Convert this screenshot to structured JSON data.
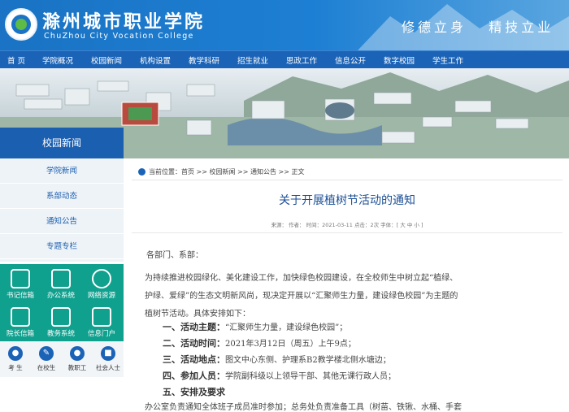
{
  "header": {
    "cn_name": "滁州城市职业学院",
    "en_name": "ChuZhou City Vocation College",
    "motto": "修德立身   精技立业"
  },
  "nav": [
    {
      "label": "首 页"
    },
    {
      "label": "学院概况"
    },
    {
      "label": "校园新闻"
    },
    {
      "label": "机构设置"
    },
    {
      "label": "教学科研"
    },
    {
      "label": "招生就业"
    },
    {
      "label": "思政工作"
    },
    {
      "label": "信息公开"
    },
    {
      "label": "数字校园"
    },
    {
      "label": "学生工作"
    }
  ],
  "sidebar": {
    "title": "校园新闻",
    "items": [
      {
        "label": "学院新闻"
      },
      {
        "label": "系部动态"
      },
      {
        "label": "通知公告"
      },
      {
        "label": "专题专栏"
      }
    ],
    "tiles": [
      {
        "label": "书记信箱",
        "icon": "mailbox-icon"
      },
      {
        "label": "办公系统",
        "icon": "monitor-icon"
      },
      {
        "label": "网络资源",
        "icon": "globe-icon"
      },
      {
        "label": "院长信箱",
        "icon": "mailbox-icon"
      },
      {
        "label": "教务系统",
        "icon": "book-icon"
      },
      {
        "label": "信息门户",
        "icon": "envelope-icon"
      }
    ],
    "audience": [
      {
        "label": "考 生"
      },
      {
        "label": "在校生"
      },
      {
        "label": "教职工"
      },
      {
        "label": "社会人士"
      }
    ]
  },
  "breadcrumb": "当前位置：首页 >> 校园新闻 >> 通知公告 >> 正文",
  "article": {
    "title": "关于开展植树节活动的通知",
    "meta": "来源：    作者：    时间：2021-03-11    点击：2次    字体：[ 大 中 小 ]",
    "lines": [
      "各部门、系部：",
      "    为持续推进校园绿化、美化建设工作，加快绿色校园建设，在全校师生中树立起“植绿、",
      "护绿、爱绿”的生态文明新风尚，现决定开展以“汇聚师生力量，建设绿色校园”为主题的",
      "植树节活动。具体安排如下："
    ],
    "items": [
      {
        "head": "一、活动主题：",
        "text": "“汇聚师生力量，建设绿色校园”；"
      },
      {
        "head": "二、活动时间：",
        "text": "2021年3月12日（周五）上午9点；"
      },
      {
        "head": "三、活动地点：",
        "text": "图文中心东侧、护理系B2教学楼北侧水塘边；"
      },
      {
        "head": "四、参加人员：",
        "text": "学院副科级以上领导干部、其他无课行政人员；"
      },
      {
        "head": "五、安排及要求",
        "text": ""
      }
    ],
    "last": "    办公室负责通知全体班子成员准时参加；总务处负责准备工具（树苗、铁锹、水桶、手套"
  }
}
